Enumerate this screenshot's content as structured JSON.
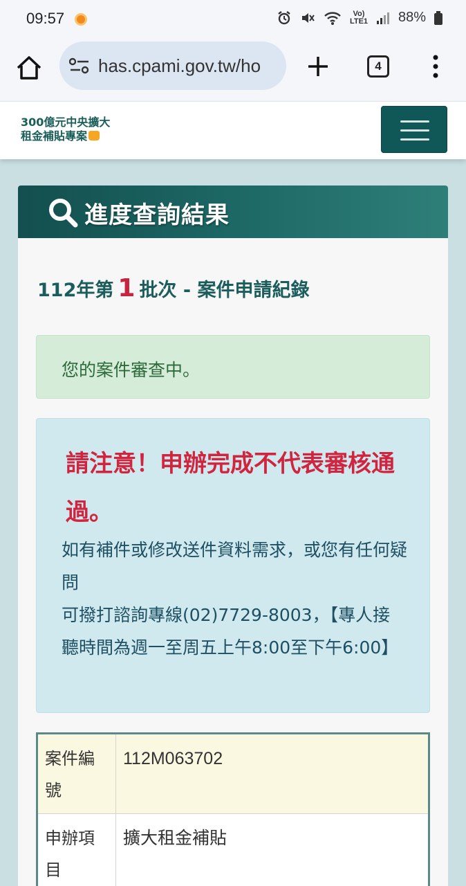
{
  "status_bar": {
    "time": "09:57",
    "battery": "88%",
    "network": "Vo) LTE1"
  },
  "browser": {
    "url": "has.cpami.gov.tw/ho",
    "tab_count": "4"
  },
  "site": {
    "logo_line1": "300億元中央擴大",
    "logo_line2": "租金補貼專案"
  },
  "card": {
    "title": "進度查詢結果",
    "batch_prefix": "112年第",
    "batch_number": "1",
    "batch_suffix": "批次 - 案件申請紀錄",
    "status_message": "您的案件審查中。",
    "warning_title": "請注意！申辦完成不代表審核通過。",
    "info_line1": "如有補件或修改送件資料需求，或您有任何疑問",
    "info_line2": "可撥打諮詢專線(02)7729-8003，【專人接聽時間為週一至周五上午8:00至下午6:00】",
    "details": [
      {
        "label": "案件編號",
        "value": "112M063702"
      },
      {
        "label": "申辦項目",
        "value": "擴大租金補貼"
      }
    ]
  },
  "colors": {
    "brand_teal": "#0f5857",
    "warning_red": "#d0243f",
    "success_bg": "#d5ecd9",
    "info_bg": "#cfe9ee"
  }
}
